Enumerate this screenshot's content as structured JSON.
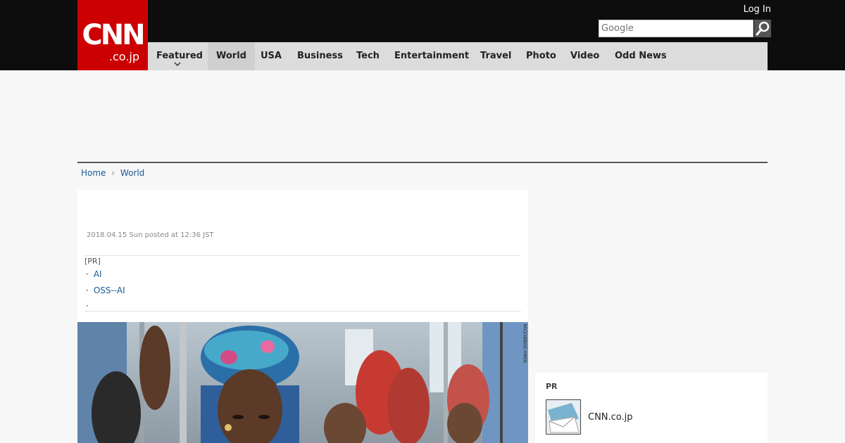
{
  "header": {
    "logo_text": "CNN",
    "logo_sub": ".co.jp",
    "login_label": "Log In",
    "search_placeholder": "Google",
    "brand_color": "#cc0000"
  },
  "nav": {
    "items": [
      {
        "label": "Featured"
      },
      {
        "label": "World"
      },
      {
        "label": "USA"
      },
      {
        "label": "Business"
      },
      {
        "label": "Tech"
      },
      {
        "label": "Entertainment"
      },
      {
        "label": "Travel"
      },
      {
        "label": "Photo"
      },
      {
        "label": "Video"
      },
      {
        "label": "Odd News"
      }
    ],
    "active": "World"
  },
  "breadcrumb": {
    "home": "Home",
    "current": "World"
  },
  "article": {
    "date": "2018.04.15 Sun posted at 12:36 JST",
    "pr_label": "[PR]",
    "pr_links": [
      "AI",
      "OSS--AI",
      ""
    ],
    "photo_credit": "NOAH DOBBY/CNN"
  },
  "sidebar": {
    "pr_heading": "PR",
    "pr_item_name": "CNN.co.jp"
  }
}
